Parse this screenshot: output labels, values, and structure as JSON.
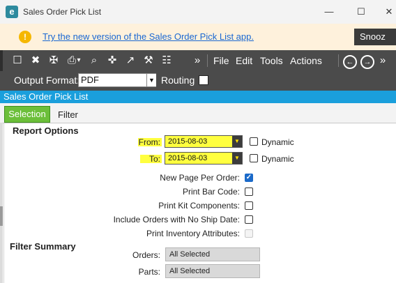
{
  "window": {
    "title": "Sales Order Pick List",
    "app_icon_letter": "e",
    "controls": [
      "—",
      "☐",
      "✕"
    ]
  },
  "banner": {
    "link_text": "Try the new version of the Sales Order Pick List app.",
    "snooze_label": "Snooz",
    "info_icon": "!"
  },
  "toolbar": {
    "menus": [
      "File",
      "Edit",
      "Tools",
      "Actions"
    ],
    "icons": [
      "new-document-icon",
      "delete-icon",
      "clear-broom-icon",
      "print-icon",
      "print-preview-icon",
      "schedule-icon",
      "route-icon",
      "tools-icon",
      "calculator-icon",
      "overflow-icon",
      "back-icon",
      "forward-icon",
      "overflow-icon"
    ],
    "glyphs": {
      "new": "☐",
      "delete": "✖",
      "clear": "✠",
      "print": "⎙",
      "preview": "⌕",
      "schedule": "✜",
      "route": "↗",
      "tools": "⚒",
      "calc": "☷",
      "more": "»",
      "back": "←",
      "forward": "→",
      "dropdown": "▾"
    }
  },
  "output": {
    "label": "Output Format:",
    "value": "PDF",
    "routing_label": "Routing",
    "routing_checked": false,
    "dropdown_arrow": "▼"
  },
  "header": {
    "title": "Sales Order Pick List"
  },
  "tabs": [
    {
      "label": "Selection",
      "selected": true
    },
    {
      "label": "Filter",
      "selected": false
    }
  ],
  "report_options": {
    "title": "Report Options",
    "from": {
      "label": "From:",
      "value": "2015-08-03",
      "dynamic_label": "Dynamic",
      "dynamic_checked": false
    },
    "to": {
      "label": "To:",
      "value": "2015-08-03",
      "dynamic_label": "Dynamic",
      "dynamic_checked": false
    },
    "checkboxes": [
      {
        "label": "New Page Per Order:",
        "checked": true,
        "enabled": true
      },
      {
        "label": "Print Bar Code:",
        "checked": false,
        "enabled": true
      },
      {
        "label": "Print Kit Components:",
        "checked": false,
        "enabled": true
      },
      {
        "label": "Include Orders with No Ship Date:",
        "checked": false,
        "enabled": true
      },
      {
        "label": "Print Inventory Attributes:",
        "checked": false,
        "enabled": false
      }
    ],
    "check_mark": "✓",
    "combo_arrow": "▼"
  },
  "filter_summary": {
    "title": "Filter Summary",
    "orders": {
      "label": "Orders:",
      "value": "All Selected"
    },
    "parts": {
      "label": "Parts:",
      "value": "All Selected"
    }
  },
  "colors": {
    "accent_blue": "#1a9fdc",
    "tab_green": "#6cbf3a",
    "highlight_yellow": "#ffff3f",
    "toolbar_gray": "#4b4b4b",
    "banner_bg": "#fef1dc",
    "checkbox_blue": "#1b6ac9"
  }
}
